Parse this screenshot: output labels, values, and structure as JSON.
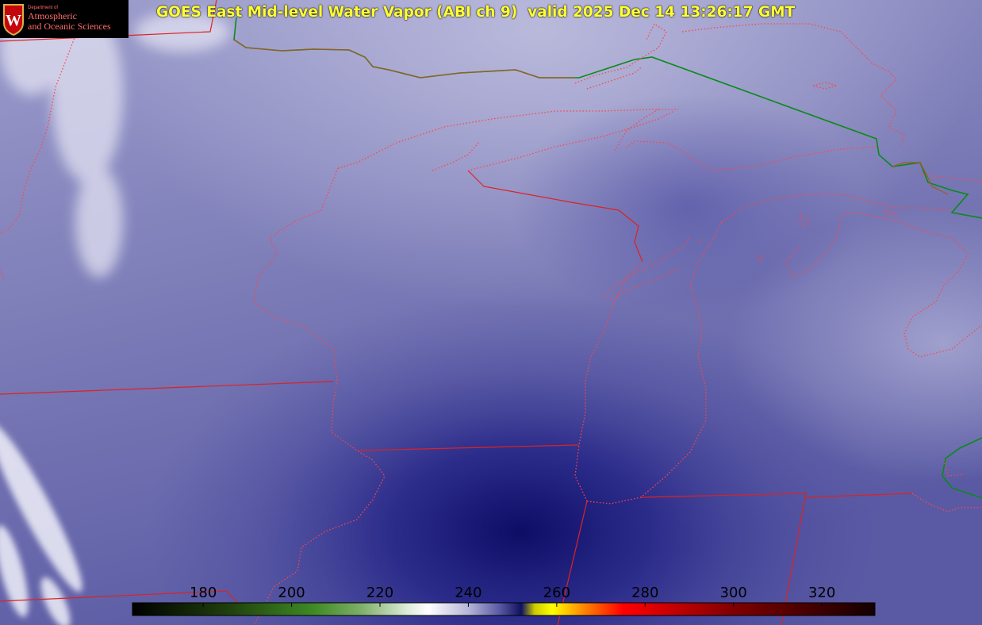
{
  "title": "GOES East Mid-level Water Vapor (ABI ch 9)  valid 2025 Dec 14 13:26:17 GMT",
  "logo": {
    "department": "Department of",
    "line1": "Atmospheric",
    "line2": "and Oceanic Sciences",
    "crest_letter": "W"
  },
  "colorbar": {
    "min": 164,
    "max": 332,
    "ticks": [
      {
        "value": 180,
        "label": "180"
      },
      {
        "value": 200,
        "label": "200"
      },
      {
        "value": 220,
        "label": "220"
      },
      {
        "value": 240,
        "label": "240"
      },
      {
        "value": 260,
        "label": "260"
      },
      {
        "value": 280,
        "label": "280"
      },
      {
        "value": 300,
        "label": "300"
      },
      {
        "value": 320,
        "label": "320"
      }
    ],
    "stops": [
      {
        "value": 164,
        "color": "#000000"
      },
      {
        "value": 185,
        "color": "#1e3d0c"
      },
      {
        "value": 205,
        "color": "#3f8a25"
      },
      {
        "value": 216,
        "color": "#80b06a"
      },
      {
        "value": 226,
        "color": "#dcebd8"
      },
      {
        "value": 231,
        "color": "#ffffff"
      },
      {
        "value": 240,
        "color": "#b6b6d8"
      },
      {
        "value": 247,
        "color": "#5a5aa6"
      },
      {
        "value": 252,
        "color": "#101060"
      },
      {
        "value": 255,
        "color": "#cccc00"
      },
      {
        "value": 259,
        "color": "#ffff00"
      },
      {
        "value": 266,
        "color": "#ff8800"
      },
      {
        "value": 275,
        "color": "#ff0000"
      },
      {
        "value": 300,
        "color": "#800000"
      },
      {
        "value": 332,
        "color": "#120000"
      }
    ]
  },
  "colors": {
    "state_border": "#e02020",
    "coast": "#ff4040",
    "international_border": "#0a8a1a",
    "title": "#ffff33"
  }
}
